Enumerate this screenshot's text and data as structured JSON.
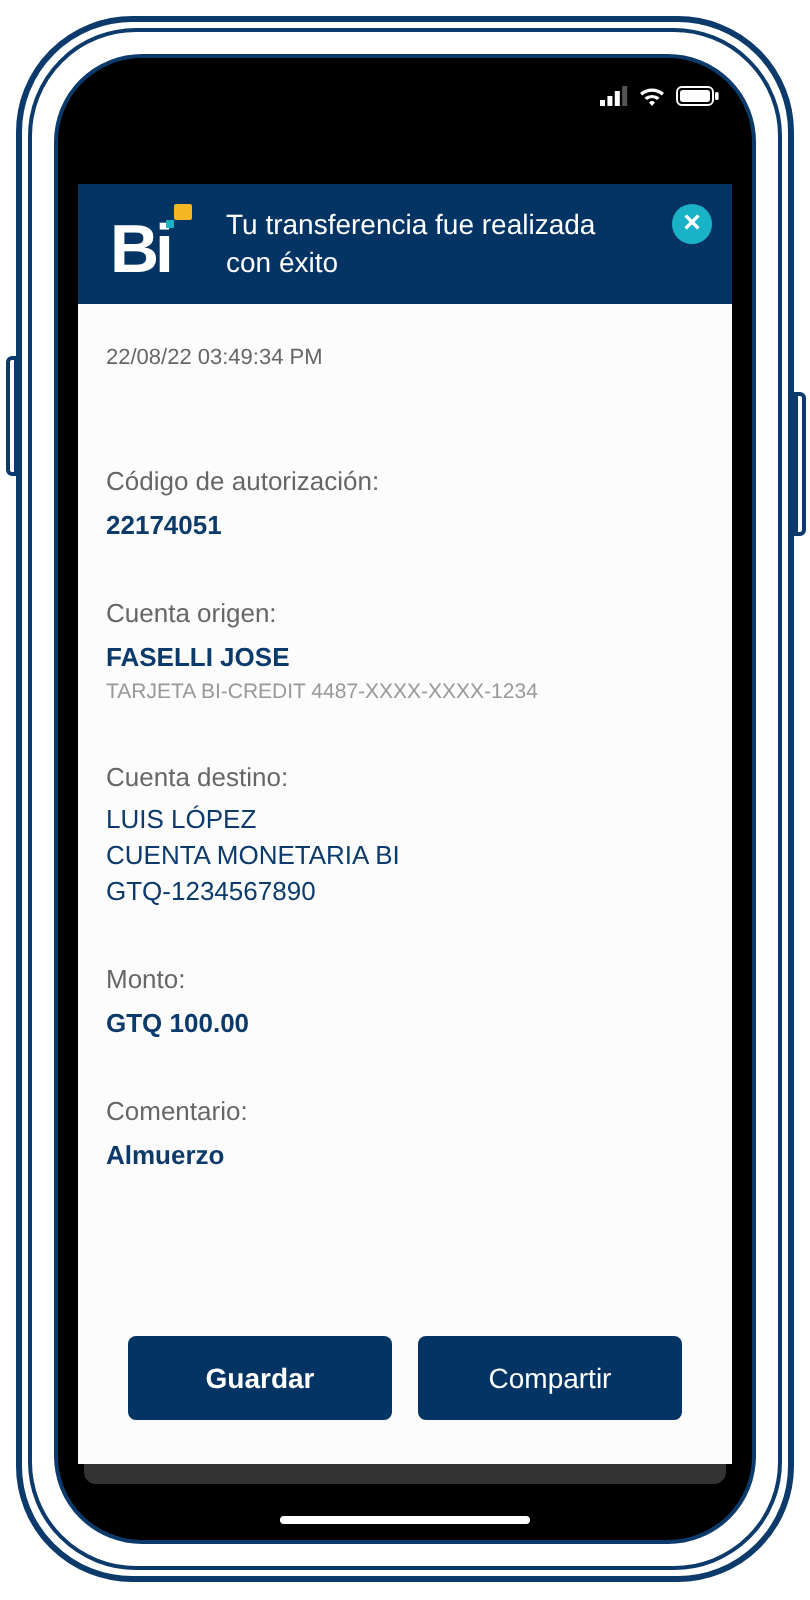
{
  "header": {
    "logo": "Bi",
    "title": "Tu transferencia fue realizada con éxito",
    "close": "×"
  },
  "timestamp": "22/08/22 03:49:34 PM",
  "fields": [
    {
      "label": "Código de autorización:",
      "lines": [
        {
          "kind": "primary",
          "text": "22174051"
        }
      ]
    },
    {
      "label": "Cuenta origen:",
      "lines": [
        {
          "kind": "primary",
          "text": "FASELLI JOSE"
        },
        {
          "kind": "secondary",
          "text": "TARJETA BI-CREDIT 4487-XXXX-XXXX-1234"
        }
      ]
    },
    {
      "label": "Cuenta destino:",
      "lines": [
        {
          "kind": "plain",
          "text": "LUIS LÓPEZ"
        },
        {
          "kind": "plain",
          "text": "CUENTA MONETARIA BI"
        },
        {
          "kind": "plain",
          "text": "GTQ-1234567890"
        }
      ]
    },
    {
      "label": "Monto:",
      "lines": [
        {
          "kind": "primary",
          "text": "GTQ 100.00"
        }
      ]
    },
    {
      "label": "Comentario:",
      "lines": [
        {
          "kind": "primary",
          "text": "Almuerzo"
        }
      ]
    }
  ],
  "buttons": [
    {
      "label": "Guardar",
      "kind": "bold"
    },
    {
      "label": "Compartir",
      "kind": "regular"
    }
  ]
}
